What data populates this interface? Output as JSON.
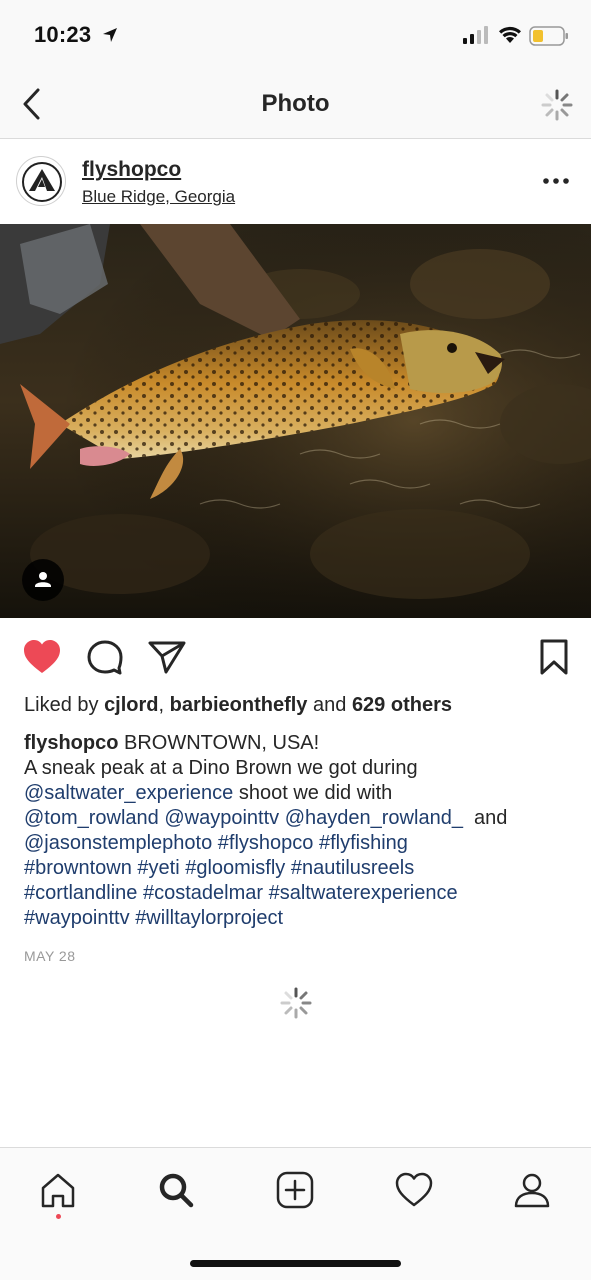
{
  "status_bar": {
    "time": "10:23",
    "icons": [
      "location-arrow-icon",
      "signal-icon",
      "wifi-icon",
      "battery-icon"
    ]
  },
  "nav": {
    "title": "Photo",
    "back_icon": "chevron-left-icon",
    "right_icon": "loading-spinner-icon"
  },
  "post": {
    "username": "flyshopco",
    "location": "Blue Ridge, Georgia",
    "more_icon": "more-horizontal-icon",
    "photo_icon": "person-tag-icon",
    "actions": {
      "like_icon": "heart-filled-icon",
      "comment_icon": "comment-icon",
      "share_icon": "paper-plane-icon",
      "save_icon": "bookmark-icon",
      "liked": true
    },
    "likes": {
      "prefix": "Liked by",
      "user1": "cjlord",
      "sep": ",",
      "user2": "barbieonthefly",
      "and": "and",
      "others": "629 others"
    },
    "caption": {
      "user": "flyshopco",
      "line1_rest": " BROWNTOWN, USA!",
      "line2": "A sneak peak at a Dino Brown we got during",
      "l3_link": "@saltwater_experience",
      "l3_text": " shoot we did with",
      "l4_link1": "@tom_rowland",
      "l4_link2": "@waypointtv",
      "l4_link3": "@hayden_rowland_",
      "l4_text": "  and",
      "l5_link1": "@jasonstemplephoto",
      "l5_link2": "#flyshopco",
      "l5_link3": "#flyfishing",
      "l6_link1": "#browntown",
      "l6_link2": "#yeti",
      "l6_link3": "#gloomisfly",
      "l6_link4": "#nautilusreels",
      "l7_link1": "#cortlandline",
      "l7_link2": "#costadelmar",
      "l7_link3": "#saltwaterexperience",
      "l8_link1": "#waypointtv",
      "l8_link2": "#willtaylorproject"
    },
    "date": "MAY 28"
  },
  "tab_bar": {
    "items": [
      "home-icon",
      "search-icon",
      "add-post-icon",
      "activity-heart-icon",
      "profile-icon"
    ],
    "active": "search-icon",
    "notification_dot_color": "#ed4956"
  },
  "colors": {
    "like_red": "#ed4956",
    "link_blue": "#1f3d6d",
    "text": "#262626",
    "muted": "#999999"
  }
}
